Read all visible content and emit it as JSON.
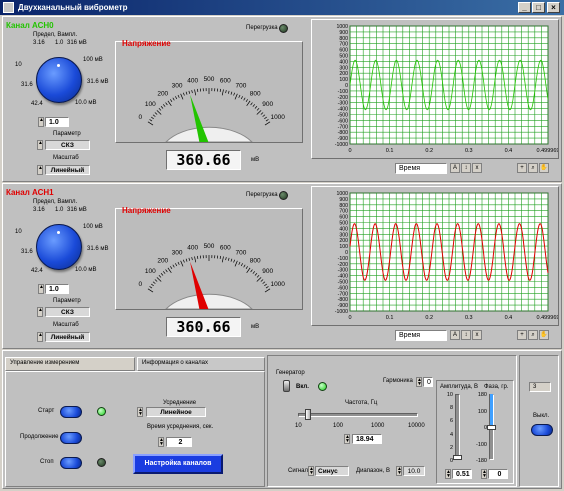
{
  "window": {
    "title": "Двухканальный виброметр"
  },
  "colors": {
    "ch0": "#22c400",
    "ch1": "#e00000",
    "title_bar": "#0a246a",
    "knob": "#1a4ad8"
  },
  "channels": [
    {
      "title": "Канал АСН0",
      "range_label": "Предел, Вампл.",
      "range_ticks": [
        "3.16",
        "1.0",
        "316 мВ",
        "10",
        "100 мВ",
        "31.6",
        "31.6 мВ",
        "42.4",
        "10.0 мВ"
      ],
      "range_value": "1.0",
      "param_label": "Параметр",
      "param_value": "СКЗ",
      "scale_label": "Масштаб",
      "scale_value": "Линейный",
      "meter_title": "Напряжение",
      "overload_label": "Перегрузка",
      "meter_ticks": [
        "0",
        "100",
        "200",
        "300",
        "400",
        "500",
        "600",
        "700",
        "800",
        "900",
        "1000"
      ],
      "meter_reading": 360.66,
      "meter_display": "360.66",
      "meter_unit": "мВ",
      "graph_y_ticks": [
        "1000",
        "900",
        "800",
        "700",
        "600",
        "500",
        "400",
        "300",
        "200",
        "100",
        "0",
        "-100",
        "-200",
        "-300",
        "-400",
        "-500",
        "-600",
        "-700",
        "-800",
        "-900",
        "-1000"
      ],
      "graph_x_ticks": [
        "0",
        "0.1",
        "0.2",
        "0.3",
        "0.4",
        "0.499969"
      ],
      "graph_x_label": "Время"
    },
    {
      "title": "Канал АСН1",
      "range_label": "Предел, Вампл.",
      "range_ticks": [
        "3.16",
        "1.0",
        "316 мВ",
        "10",
        "100 мВ",
        "31.6",
        "31.6 мВ",
        "42.4",
        "10.0 мВ"
      ],
      "range_value": "1.0",
      "param_label": "Параметр",
      "param_value": "СКЗ",
      "scale_label": "Масштаб",
      "scale_value": "Линейный",
      "meter_title": "Напряжение",
      "overload_label": "Перегрузка",
      "meter_ticks": [
        "0",
        "100",
        "200",
        "300",
        "400",
        "500",
        "600",
        "700",
        "800",
        "900",
        "1000"
      ],
      "meter_reading": 360.66,
      "meter_display": "360.66",
      "meter_unit": "мВ",
      "graph_y_ticks": [
        "1000",
        "900",
        "800",
        "700",
        "600",
        "500",
        "400",
        "300",
        "200",
        "100",
        "0",
        "-100",
        "-200",
        "-300",
        "-400",
        "-500",
        "-600",
        "-700",
        "-800",
        "-900",
        "-1000"
      ],
      "graph_x_ticks": [
        "0",
        "0.1",
        "0.2",
        "0.3",
        "0.4",
        "0.499969"
      ],
      "graph_x_label": "Время"
    }
  ],
  "control": {
    "tabs": [
      "Управление измерением",
      "Информация о каналах"
    ],
    "start_label": "Старт",
    "continue_label": "Продолжение",
    "stop_label": "Стоп",
    "averaging_label": "Усреднение",
    "averaging_value": "Линейное",
    "avg_time_label": "Время усреднения, сек.",
    "avg_time_value": "2",
    "channel_settings_button": "Настройка каналов"
  },
  "generator": {
    "title": "Генератор",
    "on_label": "Вкл.",
    "harmonic_label": "Гармоника",
    "harmonic_value": "0",
    "freq_label": "Частота, Гц",
    "freq_ticks": [
      "10",
      "100",
      "1000",
      "10000"
    ],
    "freq_value": "18.94",
    "signal_label": "Сигнал",
    "signal_value": "Синус",
    "range_label": "Диапазон, В",
    "range_value": "10.0",
    "amp_label": "Амплитуда, В",
    "amp_ticks": [
      "10",
      "8",
      "6",
      "4",
      "2",
      "0"
    ],
    "amp_value": "0.51",
    "phase_label": "Фаза, гр.",
    "phase_ticks": [
      "180",
      "100",
      "0",
      "-100",
      "-180"
    ],
    "phase_value": "0"
  },
  "exit": {
    "counter": "3",
    "label": "Выкл."
  }
}
